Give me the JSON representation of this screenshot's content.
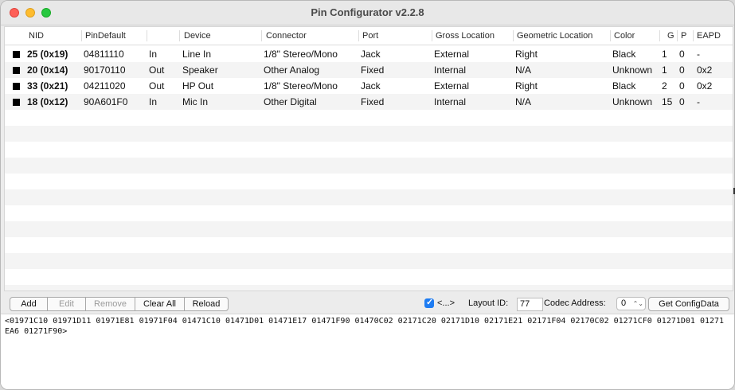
{
  "window": {
    "title": "Pin Configurator v2.2.8"
  },
  "table": {
    "columns": [
      "NID",
      "PinDefault",
      "",
      "Device",
      "Connector",
      "Port",
      "Gross Location",
      "Geometric Location",
      "Color",
      "G",
      "P",
      "EAPD"
    ],
    "rows": [
      {
        "swatch": "#000000",
        "nid": "25 (0x19)",
        "pindefault": "04811110",
        "dir": "In",
        "device": "Line In",
        "connector": "1/8\" Stereo/Mono",
        "port": "Jack",
        "gross": "External",
        "geometric": "Right",
        "color": "Black",
        "g": "1",
        "p": "0",
        "eapd": "-"
      },
      {
        "swatch": "#000000",
        "nid": "20 (0x14)",
        "pindefault": "90170110",
        "dir": "Out",
        "device": "Speaker",
        "connector": "Other Analog",
        "port": "Fixed",
        "gross": "Internal",
        "geometric": "N/A",
        "color": "Unknown",
        "g": "1",
        "p": "0",
        "eapd": "0x2"
      },
      {
        "swatch": "#000000",
        "nid": "33 (0x21)",
        "pindefault": "04211020",
        "dir": "Out",
        "device": "HP Out",
        "connector": "1/8\" Stereo/Mono",
        "port": "Jack",
        "gross": "External",
        "geometric": "Right",
        "color": "Black",
        "g": "2",
        "p": "0",
        "eapd": "0x2"
      },
      {
        "swatch": "#000000",
        "nid": "18 (0x12)",
        "pindefault": "90A601F0",
        "dir": "In",
        "device": "Mic In",
        "connector": "Other Digital",
        "port": "Fixed",
        "gross": "Internal",
        "geometric": "N/A",
        "color": "Unknown",
        "g": "15",
        "p": "0",
        "eapd": "-"
      }
    ]
  },
  "toolbar": {
    "add": "Add",
    "edit": "Edit",
    "remove": "Remove",
    "clear_all": "Clear All",
    "reload": "Reload",
    "checkbox_label": "<...>",
    "checkbox_checked": true,
    "layout_id_label": "Layout ID:",
    "layout_id_value": "77",
    "codec_address_label": "Codec Address:",
    "codec_address_value": "0",
    "get_config": "Get ConfigData"
  },
  "output": {
    "text": "<01971C10 01971D11 01971E81 01971F04 01471C10 01471D01 01471E17 01471F90 01470C02 02171C20 02171D10 02171E21 02171F04 02170C02 01271CF0 01271D01 01271EA6 01271F90>"
  },
  "colors": {
    "accent": "#1e7cf2",
    "close": "#fe5f57",
    "minimize": "#febc2e",
    "maximize": "#28c840"
  }
}
